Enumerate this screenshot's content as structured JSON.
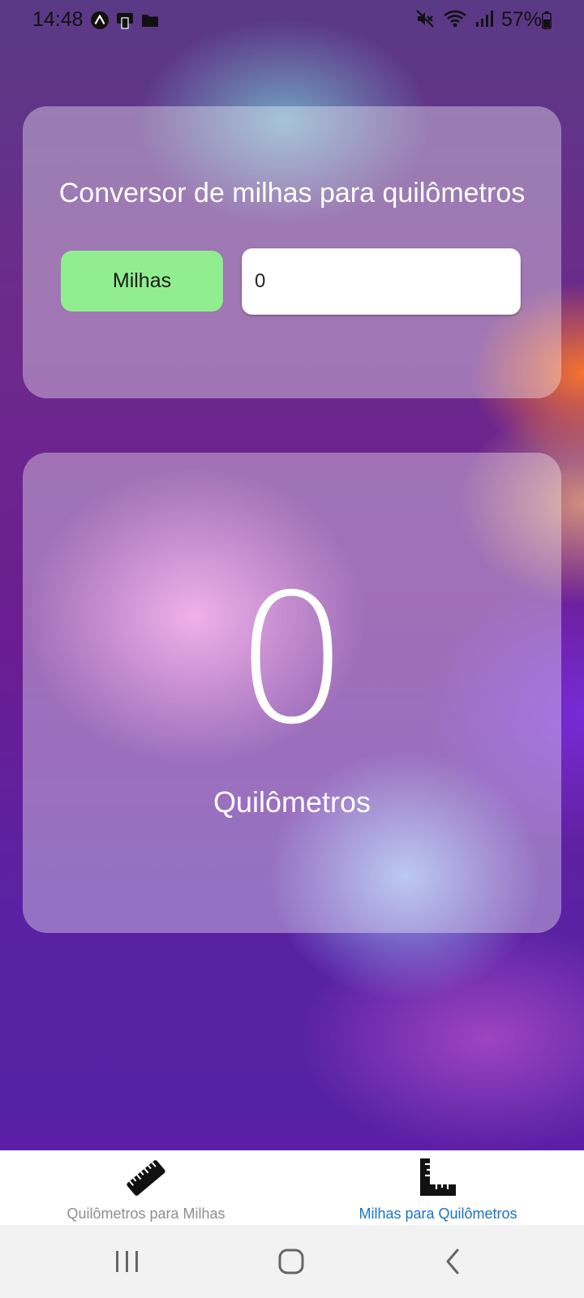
{
  "status_bar": {
    "time": "14:48",
    "battery_text": "57%",
    "left_icons": [
      "expo-icon",
      "cast-icon",
      "folder-icon"
    ],
    "right_icons": [
      "mute-icon",
      "wifi-icon",
      "signal-icon",
      "battery-icon"
    ]
  },
  "converter": {
    "title": "Conversor de milhas para quilômetros",
    "unit_label": "Milhas",
    "input_value": "0"
  },
  "result": {
    "value": "0",
    "unit": "Quilômetros"
  },
  "tabs": [
    {
      "label": "Quilômetros para Milhas",
      "icon": "ruler-icon",
      "active": false
    },
    {
      "label": "Milhas para Quilômetros",
      "icon": "square-ruler-icon",
      "active": true
    }
  ],
  "colors": {
    "unit_label_bg": "#90ee90",
    "active_tab": "#1a73c8",
    "inactive_tab": "#8e8e93"
  }
}
